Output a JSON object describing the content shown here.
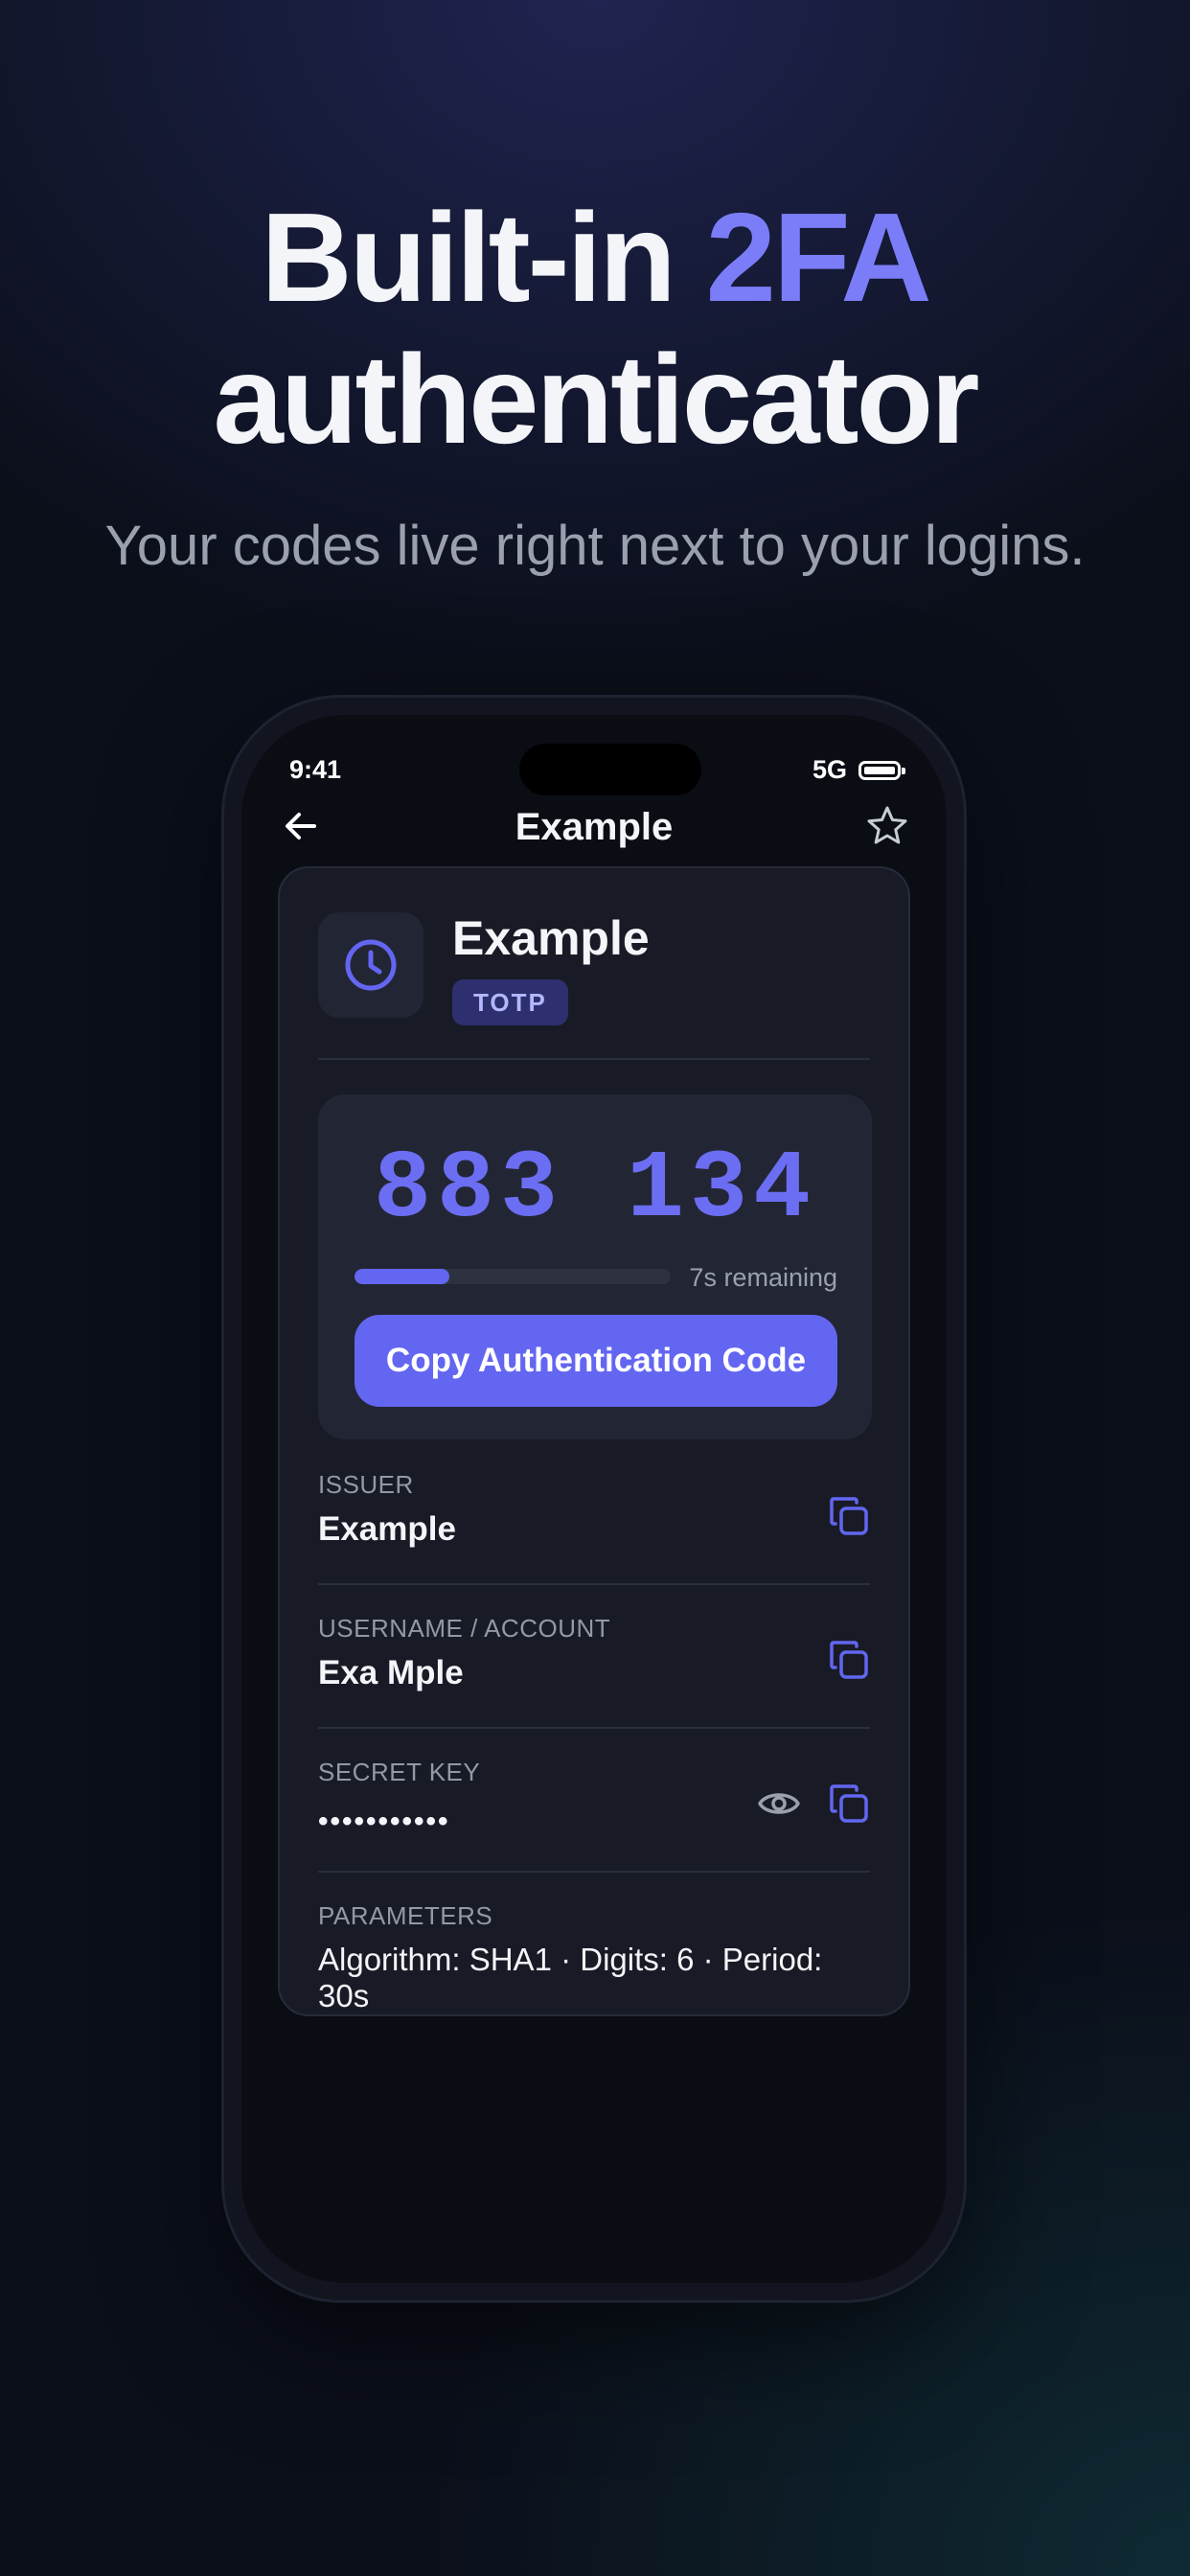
{
  "hero": {
    "title_line1_prefix": "Built-in ",
    "title_line1_accent": "2FA",
    "title_line2": "authenticator",
    "subtitle": "Your codes live right next to your logins."
  },
  "status_bar": {
    "time": "9:41",
    "network": "5G"
  },
  "nav": {
    "title": "Example"
  },
  "entry": {
    "name": "Example",
    "type_badge": "TOTP",
    "code": "883 134",
    "remaining": "7s remaining",
    "progress_fraction": 0.3,
    "copy_button": "Copy Authentication Code"
  },
  "fields": {
    "issuer": {
      "label": "ISSUER",
      "value": "Example"
    },
    "username": {
      "label": "USERNAME / ACCOUNT",
      "value": "Exa Mple"
    },
    "secret": {
      "label": "SECRET KEY",
      "value": "•••••••••••"
    },
    "parameters": {
      "label": "PARAMETERS",
      "value": "Algorithm: SHA1 · Digits: 6 · Period: 30s"
    }
  },
  "colors": {
    "accent": "#6366f1",
    "accent_light": "#7b7df8",
    "background": "#0b0f1a",
    "card": "#181b26"
  }
}
